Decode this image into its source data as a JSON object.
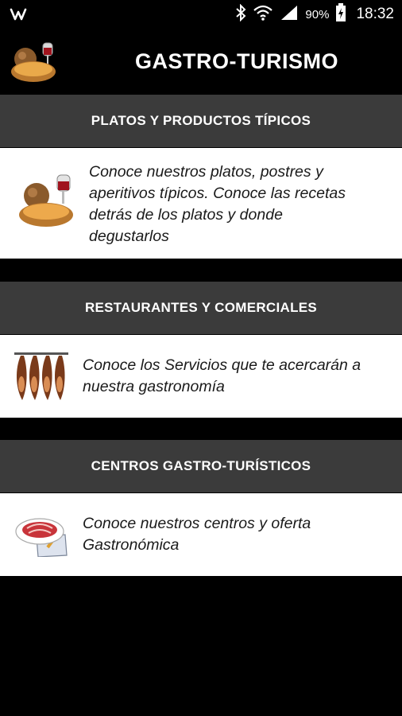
{
  "status_bar": {
    "battery": "90%",
    "time": "18:32",
    "icons": [
      "wish-icon",
      "bluetooth-icon",
      "wifi-icon",
      "signal-icon",
      "battery-icon"
    ]
  },
  "app_bar": {
    "title": "GASTRO-TURISMO",
    "logo": "food-basket-icon"
  },
  "sections": [
    {
      "header": "PLATOS Y PRODUCTOS TÍPICOS",
      "description": "Conoce nuestros platos, postres y aperitivos típicos. Conoce las recetas detrás de los platos y donde degustarlos",
      "icon": "food-basket-icon"
    },
    {
      "header": "RESTAURANTES Y COMERCIALES",
      "description": "Conoce los Servicios que te acercarán a nuestra gastronomía",
      "icon": "hams-icon"
    },
    {
      "header": "CENTROS GASTRO-TURÍSTICOS",
      "description": "Conoce nuestros centros y oferta Gastronómica",
      "icon": "ham-plate-icon"
    }
  ],
  "colors": {
    "header_bg": "#3b3b3b",
    "card_bg": "#ffffff",
    "page_bg": "#000000"
  }
}
